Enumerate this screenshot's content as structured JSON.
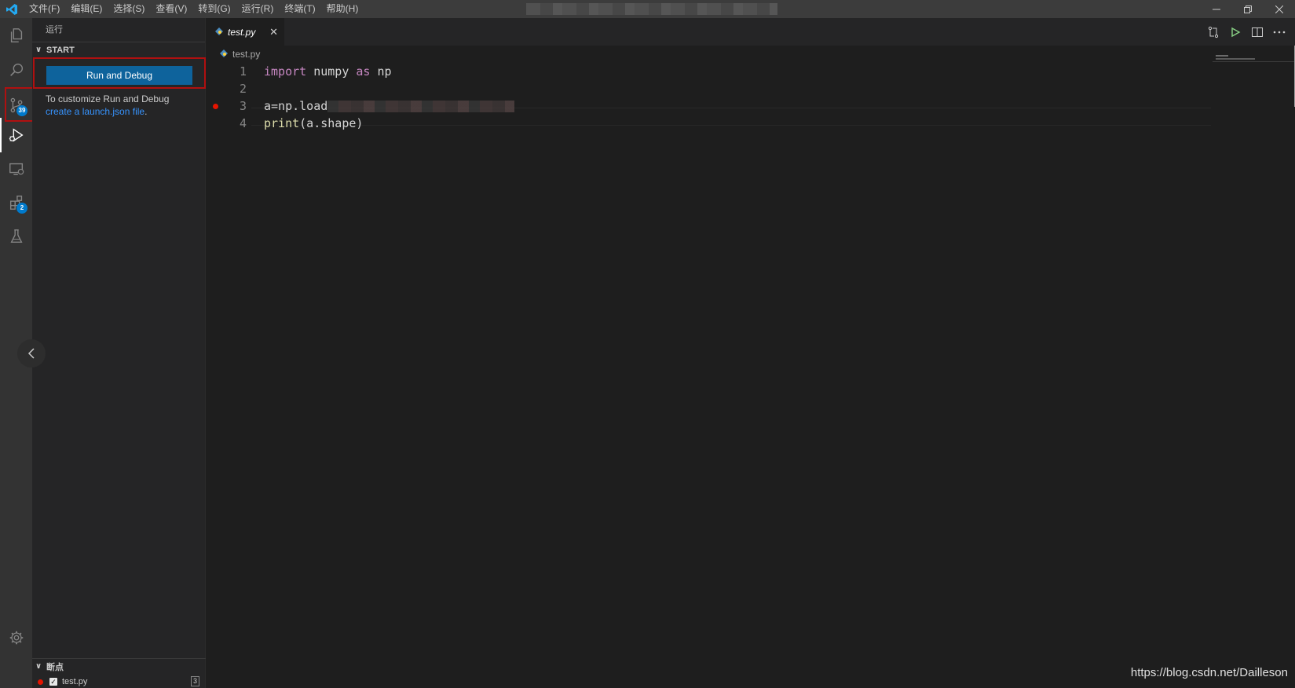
{
  "titlebar": {
    "menu": [
      "文件(F)",
      "编辑(E)",
      "选择(S)",
      "查看(V)",
      "转到(G)",
      "运行(R)",
      "终端(T)",
      "帮助(H)"
    ],
    "title": "",
    "controls": [
      "minimize-icon",
      "restore-icon",
      "close-icon"
    ]
  },
  "activitybar": {
    "items": [
      {
        "name": "explorer-icon"
      },
      {
        "name": "search-icon"
      },
      {
        "name": "source-control-icon",
        "badge": "39"
      },
      {
        "name": "run-debug-icon"
      },
      {
        "name": "remote-explorer-icon"
      },
      {
        "name": "extensions-icon",
        "badge": "2"
      },
      {
        "name": "testing-icon"
      }
    ],
    "settings": "gear-icon"
  },
  "sidebar": {
    "title": "运行",
    "start_section": "START",
    "run_button": "Run and Debug",
    "help_prefix": "To customize Run and Debug ",
    "help_link": "create a launch.json file",
    "help_suffix": ".",
    "breakpoints_section": "断点",
    "breakpoint": {
      "file": "test.py",
      "count": "3"
    }
  },
  "editor": {
    "tab_label": "test.py",
    "breadcrumb": "test.py",
    "lines": [
      {
        "num": "1"
      },
      {
        "num": "2"
      },
      {
        "num": "3"
      },
      {
        "num": "4"
      }
    ],
    "code": {
      "l1_kw1": "import",
      "l1_mod": " numpy ",
      "l1_kw2": "as",
      "l1_alias": " np",
      "l3": "a=np.load",
      "l4_fn": "print",
      "l4_rest": "(a.shape)"
    }
  },
  "colors": {
    "accent": "#007acc",
    "button": "#0e639c",
    "breakpoint": "#e51400",
    "highlight_box": "#b01010"
  },
  "watermark": "https://blog.csdn.net/Dailleson"
}
